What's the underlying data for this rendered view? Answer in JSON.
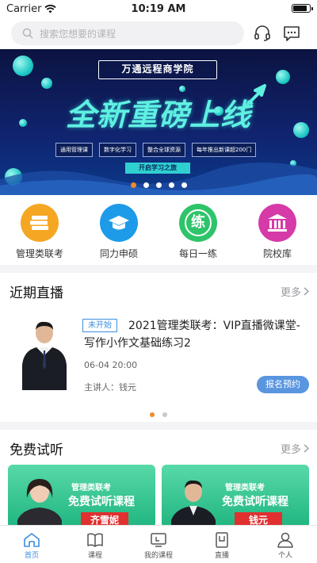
{
  "status_bar": {
    "carrier": "Carrier",
    "time": "10:19 AM",
    "battery_level": 0.9
  },
  "search": {
    "placeholder": "搜索您想要的课程"
  },
  "header_icons": [
    "headset-icon",
    "chat-icon"
  ],
  "banner": {
    "brand": "万通远程商学院",
    "headline": "全新重磅上线",
    "tags": [
      "通用管理课",
      "数字化学习",
      "整合全球资源",
      "每年推出新课超200门"
    ],
    "cta": "开启学习之旅",
    "page_count": 5,
    "active_page": 0
  },
  "quick_nav": [
    {
      "label": "管理类联考",
      "icon": "books-icon",
      "color": "#f5a623"
    },
    {
      "label": "同力申硕",
      "icon": "graduation-cap-icon",
      "color": "#1e9be8"
    },
    {
      "label": "每日一练",
      "icon": "practice-icon",
      "color": "#2ec46a",
      "glyph": "练"
    },
    {
      "label": "院校库",
      "icon": "university-icon",
      "color": "#d63aa8"
    }
  ],
  "live": {
    "title": "近期直播",
    "more": "更多",
    "item": {
      "status": "未开始",
      "title_line1": "2021管理类联考：VIP直播微课堂-",
      "title_line2": "写作小作文基础练习2",
      "time": "06-04 20:00",
      "lecturer": "主讲人：钱元",
      "button": "报名预约"
    },
    "page_count": 2,
    "active_page": 0
  },
  "free": {
    "title": "免费试听",
    "more": "更多",
    "cards": [
      {
        "sub": "管理类联考",
        "main": "免费试听课程",
        "name": "齐雪妮"
      },
      {
        "sub": "管理类联考",
        "main": "免费试听课程",
        "name": "钱元"
      }
    ]
  },
  "tabs": [
    {
      "label": "首页",
      "icon": "home-icon",
      "active": true
    },
    {
      "label": "课程",
      "icon": "book-icon",
      "active": false
    },
    {
      "label": "我的课程",
      "icon": "my-courses-icon",
      "active": false
    },
    {
      "label": "直播",
      "icon": "live-icon",
      "active": false
    },
    {
      "label": "个人",
      "icon": "person-icon",
      "active": false
    }
  ],
  "colors": {
    "accent": "#3a8ee0",
    "pager_active": "#f08a2a",
    "reserve_button": "#5a95e0"
  }
}
